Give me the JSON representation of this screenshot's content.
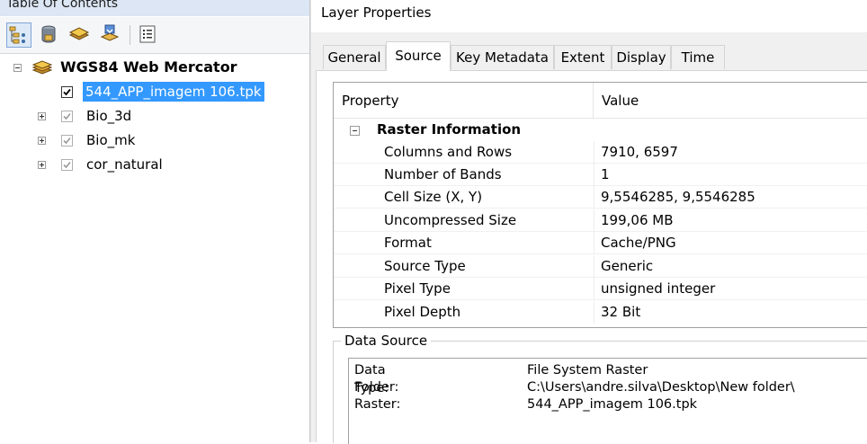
{
  "toc": {
    "title": "Table Of Contents",
    "toolbar": [
      {
        "icon": "list-by-drawing-order-icon",
        "active": true
      },
      {
        "icon": "list-by-source-icon"
      },
      {
        "icon": "list-by-visibility-icon"
      },
      {
        "icon": "list-by-selection-icon"
      },
      {
        "icon": "options-icon"
      }
    ],
    "data_frame": {
      "label": "WGS84 Web Mercator",
      "expanded": true
    },
    "layers": [
      {
        "label": "544_APP_imagem 106.tpk",
        "checked": true,
        "selected": true
      },
      {
        "label": "Bio_3d",
        "checked": true,
        "selected": false
      },
      {
        "label": "Bio_mk",
        "checked": true,
        "selected": false
      },
      {
        "label": "cor_natural",
        "checked": true,
        "selected": false
      }
    ]
  },
  "dialog": {
    "title": "Layer Properties",
    "tabs": [
      "General",
      "Source",
      "Key Metadata",
      "Extent",
      "Display",
      "Time"
    ],
    "active_tab": "Source",
    "table": {
      "headers": [
        "Property",
        "Value"
      ],
      "section": "Raster Information",
      "rows": [
        {
          "name": "Columns and Rows",
          "value": "7910, 6597"
        },
        {
          "name": "Number of Bands",
          "value": "1"
        },
        {
          "name": "Cell Size (X, Y)",
          "value": "9,5546285, 9,5546285"
        },
        {
          "name": "Uncompressed Size",
          "value": "199,06 MB"
        },
        {
          "name": "Format",
          "value": "Cache/PNG"
        },
        {
          "name": "Source Type",
          "value": "Generic"
        },
        {
          "name": "Pixel Type",
          "value": "unsigned integer"
        },
        {
          "name": "Pixel Depth",
          "value": "32 Bit"
        }
      ]
    },
    "data_source": {
      "legend": "Data Source",
      "lines": [
        {
          "key": "Data Type:",
          "value": "File System Raster"
        },
        {
          "key": "Folder:",
          "value": "C:\\Users\\andre.silva\\Desktop\\New folder\\"
        },
        {
          "key": "Raster:",
          "value": "544_APP_imagem 106.tpk"
        }
      ]
    }
  },
  "colors": {
    "selection": "#3399ff",
    "toc_title_bg": "#dce6f4",
    "dialog_bg": "#f0f0f0"
  }
}
